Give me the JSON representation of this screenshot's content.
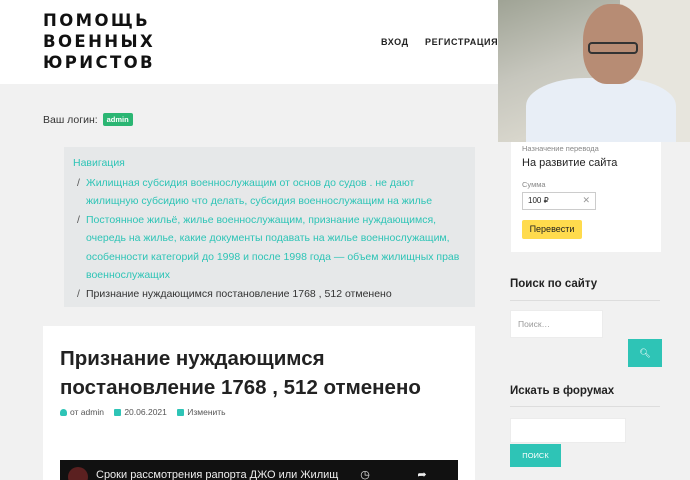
{
  "header": {
    "logo_lines": [
      "ПОМОЩЬ",
      "ВОЕННЫХ",
      "ЮРИСТОВ"
    ],
    "nav": {
      "login": "ВХОД",
      "register": "РЕГИСТРАЦИЯ"
    }
  },
  "login_status": {
    "label": "Ваш логин:",
    "username": "admin"
  },
  "breadcrumbs": {
    "title": "Навигация",
    "separator": "/",
    "items": [
      "Жилищная субсидия военнослужащим от основ до судов . не дают жилищную субсидию что делать, субсидия военнослужащим на жилье",
      "Постоянное жильё, жилье военнослужащим, признание нуждающимся, очередь на жилье, какие документы подавать на жилье военнослужащим, особенности категорий до 1998 и после 1998 года — объем жилищных прав военнослужащих"
    ],
    "current": "Признание нуждающимся постановление 1768 , 512 отменено"
  },
  "article": {
    "title": "Признание нуждающимся постановление 1768 , 512 отменено",
    "meta": {
      "author": "от admin",
      "date": "20.06.2021",
      "edit": "Изменить"
    },
    "video_title": "Сроки рассмотрения рапорта ДЖО или Жилищ"
  },
  "sidebar": {
    "donate": {
      "purpose_label": "Назначение перевода",
      "purpose": "На развитие сайта",
      "sum_label": "Сумма",
      "sum_value": "100 ₽",
      "button": "Перевести"
    },
    "search": {
      "title": "Поиск по сайту",
      "placeholder": "Поиск…"
    },
    "forum_search": {
      "title": "Искать в форумах",
      "button": "ПОИСК"
    }
  },
  "colors": {
    "accent": "#2ec4b6",
    "badge": "#2bb673",
    "donate_button": "#ffdb4d"
  }
}
